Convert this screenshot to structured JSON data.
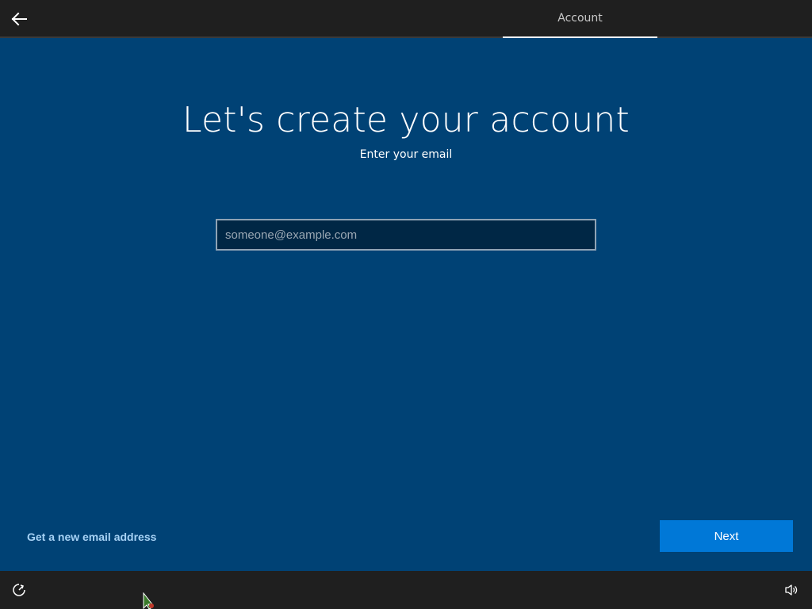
{
  "header": {
    "back_icon": "arrow-left-icon",
    "tab_label": "Account"
  },
  "main": {
    "title": "Let's create your account",
    "subtitle": "Enter your email",
    "email_input": {
      "value": "",
      "placeholder": "someone@example.com"
    },
    "new_email_link": "Get a new email address",
    "next_label": "Next"
  },
  "footer": {
    "ease_icon": "ease-of-access-icon",
    "volume_icon": "volume-icon"
  },
  "colors": {
    "background": "#004275",
    "bar": "#1f1f1f",
    "accent": "#0078d7",
    "link": "#a6d2f5"
  }
}
